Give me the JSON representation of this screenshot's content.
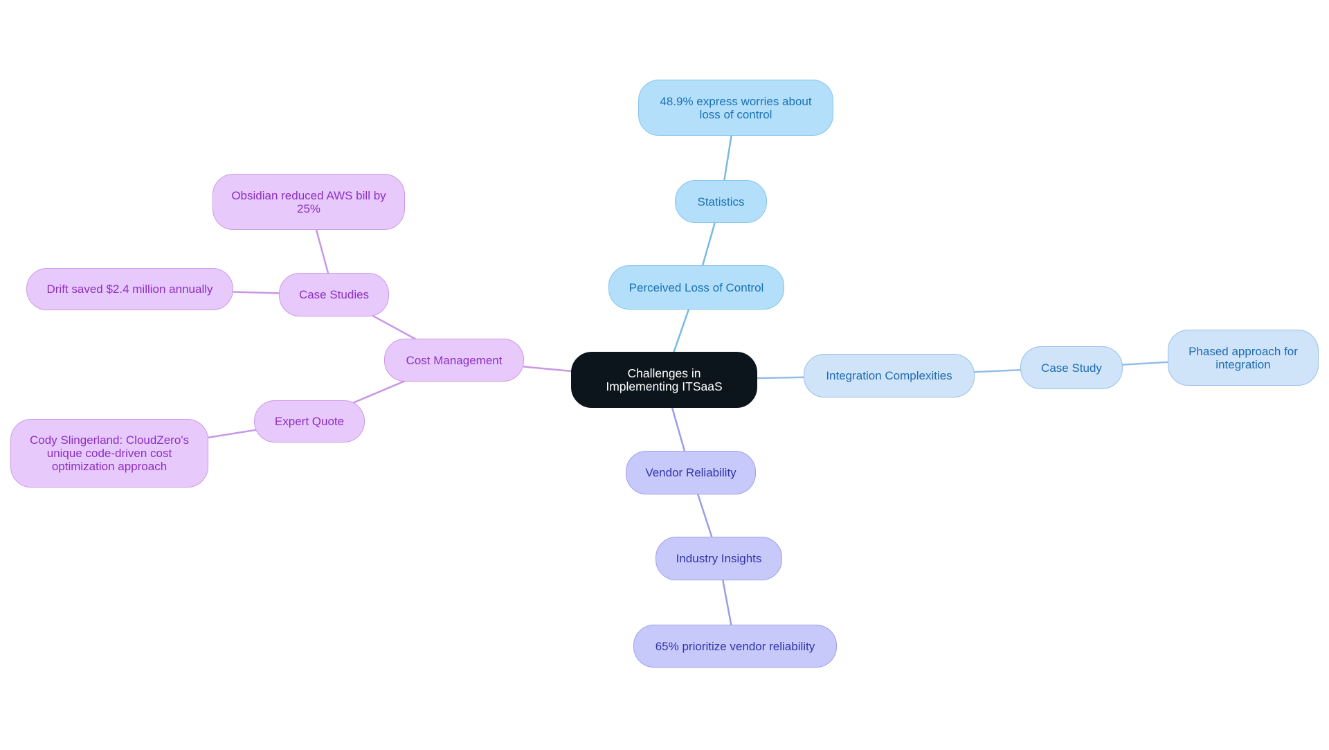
{
  "title": "Challenges in Implementing ITSaaS",
  "colors": {
    "root_fill": "#0c141c",
    "perceived_loss_branch": "#b3dffb",
    "perceived_loss_edge": "#7ab9e2",
    "integration_branch": "#cfe3f9",
    "integration_edge": "#93bde6",
    "vendor_branch": "#c7c9fb",
    "vendor_edge": "#9a9de6",
    "cost_branch": "#e8c9fc",
    "cost_edge": "#c896e6"
  },
  "nodes": {
    "root": "Challenges in Implementing ITSaaS",
    "perceived_loss": "Perceived Loss of Control",
    "statistics": "Statistics",
    "stat_48_9": "48.9% express worries about loss of control",
    "integration": "Integration Complexities",
    "case_study": "Case Study",
    "phased": "Phased approach for integration",
    "vendor": "Vendor Reliability",
    "industry_insights": "Industry Insights",
    "stat_65": "65% prioritize vendor reliability",
    "cost": "Cost Management",
    "case_studies": "Case Studies",
    "obsidian": "Obsidian reduced AWS bill by 25%",
    "drift": "Drift saved $2.4 million annually",
    "expert_quote": "Expert Quote",
    "cody": "Cody Slingerland: CloudZero's unique code-driven cost optimization approach"
  },
  "edges": [
    [
      "root",
      "perceived_loss",
      "perceived_loss_edge"
    ],
    [
      "perceived_loss",
      "statistics",
      "perceived_loss_edge"
    ],
    [
      "statistics",
      "stat_48_9",
      "perceived_loss_edge"
    ],
    [
      "root",
      "integration",
      "integration_edge"
    ],
    [
      "integration",
      "case_study",
      "integration_edge"
    ],
    [
      "case_study",
      "phased",
      "integration_edge"
    ],
    [
      "root",
      "vendor",
      "vendor_edge"
    ],
    [
      "vendor",
      "industry_insights",
      "vendor_edge"
    ],
    [
      "industry_insights",
      "stat_65",
      "vendor_edge"
    ],
    [
      "root",
      "cost",
      "cost_edge"
    ],
    [
      "cost",
      "case_studies",
      "cost_edge"
    ],
    [
      "case_studies",
      "obsidian",
      "cost_edge"
    ],
    [
      "case_studies",
      "drift",
      "cost_edge"
    ],
    [
      "cost",
      "expert_quote",
      "cost_edge"
    ],
    [
      "expert_quote",
      "cody",
      "cost_edge"
    ]
  ]
}
